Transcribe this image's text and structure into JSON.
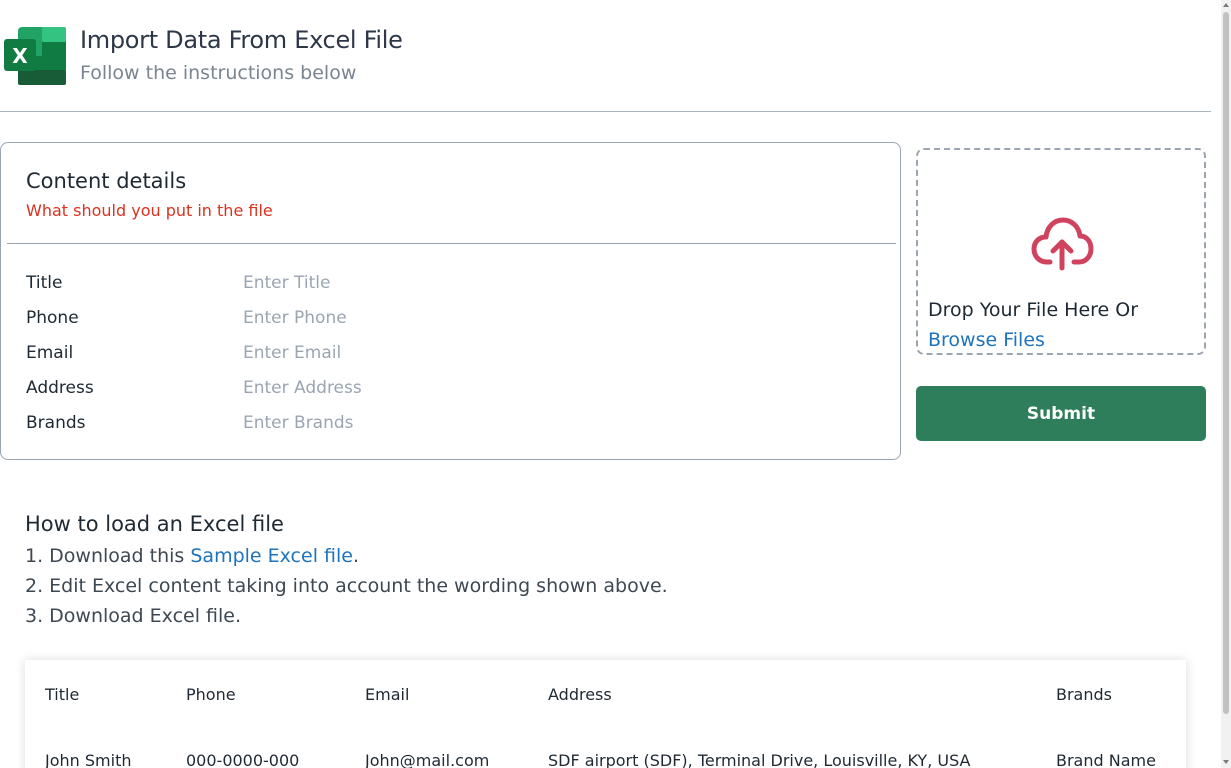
{
  "header": {
    "title": "Import Data From Excel File",
    "subtitle": "Follow the instructions below",
    "logo_icon": "excel-icon",
    "logo_letter": "X"
  },
  "content_details": {
    "title": "Content details",
    "subtitle": "What should you put in the file",
    "fields": [
      {
        "label": "Title",
        "placeholder": "Enter Title"
      },
      {
        "label": "Phone",
        "placeholder": "Enter Phone"
      },
      {
        "label": "Email",
        "placeholder": "Enter Email"
      },
      {
        "label": "Address",
        "placeholder": "Enter Address"
      },
      {
        "label": "Brands",
        "placeholder": "Enter Brands"
      }
    ]
  },
  "upload": {
    "icon": "cloud-upload-icon",
    "drop_text": "Drop Your File Here Or",
    "browse_label": "Browse Files"
  },
  "submit_label": "Submit",
  "howto": {
    "title": "How to load an Excel file",
    "step1_prefix": "1. Download this ",
    "step1_link": "Sample Excel file",
    "step1_suffix": ".",
    "step2": "2. Edit Excel content taking into account the wording shown above.",
    "step3": "3. Download Excel file."
  },
  "table": {
    "headers": [
      "Title",
      "Phone",
      "Email",
      "Address",
      "Brands"
    ],
    "rows": [
      [
        "John Smith",
        "000-0000-000",
        "John@mail.com",
        "SDF airport (SDF), Terminal Drive, Louisville, KY, USA",
        "Brand Name"
      ]
    ]
  },
  "colors": {
    "accent_green": "#2e7d5b",
    "link_blue": "#1e73be",
    "hint_red": "#d9321e",
    "upload_icon": "#d0435e"
  }
}
